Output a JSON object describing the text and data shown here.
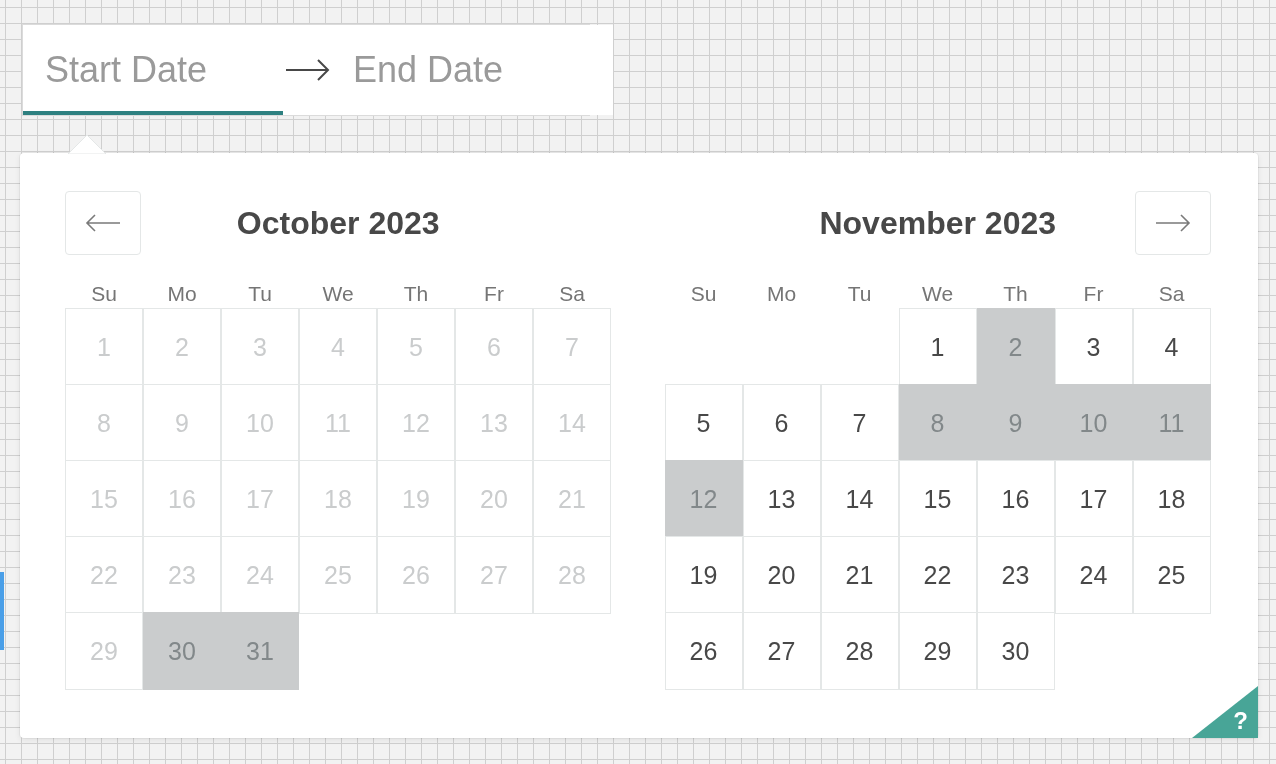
{
  "date_range": {
    "start": {
      "placeholder": "Start Date",
      "selected": true
    },
    "end": {
      "placeholder": "End Date",
      "selected": false
    }
  },
  "months": [
    {
      "title": "October 2023",
      "prev_button": true,
      "next_button": false,
      "weekdays": [
        "Su",
        "Mo",
        "Tu",
        "We",
        "Th",
        "Fr",
        "Sa"
      ],
      "weeks": [
        [
          {
            "label": "1",
            "disabled": true,
            "highlighted": false
          },
          {
            "label": "2",
            "disabled": true,
            "highlighted": false
          },
          {
            "label": "3",
            "disabled": true,
            "highlighted": false
          },
          {
            "label": "4",
            "disabled": true,
            "highlighted": false
          },
          {
            "label": "5",
            "disabled": true,
            "highlighted": false
          },
          {
            "label": "6",
            "disabled": true,
            "highlighted": false
          },
          {
            "label": "7",
            "disabled": true,
            "highlighted": false
          }
        ],
        [
          {
            "label": "8",
            "disabled": true,
            "highlighted": false
          },
          {
            "label": "9",
            "disabled": true,
            "highlighted": false
          },
          {
            "label": "10",
            "disabled": true,
            "highlighted": false
          },
          {
            "label": "11",
            "disabled": true,
            "highlighted": false
          },
          {
            "label": "12",
            "disabled": true,
            "highlighted": false
          },
          {
            "label": "13",
            "disabled": true,
            "highlighted": false
          },
          {
            "label": "14",
            "disabled": true,
            "highlighted": false
          }
        ],
        [
          {
            "label": "15",
            "disabled": true,
            "highlighted": false
          },
          {
            "label": "16",
            "disabled": true,
            "highlighted": false
          },
          {
            "label": "17",
            "disabled": true,
            "highlighted": false
          },
          {
            "label": "18",
            "disabled": true,
            "highlighted": false
          },
          {
            "label": "19",
            "disabled": true,
            "highlighted": false
          },
          {
            "label": "20",
            "disabled": true,
            "highlighted": false
          },
          {
            "label": "21",
            "disabled": true,
            "highlighted": false
          }
        ],
        [
          {
            "label": "22",
            "disabled": true,
            "highlighted": false
          },
          {
            "label": "23",
            "disabled": true,
            "highlighted": false
          },
          {
            "label": "24",
            "disabled": true,
            "highlighted": false
          },
          {
            "label": "25",
            "disabled": true,
            "highlighted": false
          },
          {
            "label": "26",
            "disabled": true,
            "highlighted": false
          },
          {
            "label": "27",
            "disabled": true,
            "highlighted": false
          },
          {
            "label": "28",
            "disabled": true,
            "highlighted": false
          }
        ],
        [
          {
            "label": "29",
            "disabled": true,
            "highlighted": false
          },
          {
            "label": "30",
            "disabled": true,
            "highlighted": true
          },
          {
            "label": "31",
            "disabled": true,
            "highlighted": true
          }
        ]
      ]
    },
    {
      "title": "November 2023",
      "prev_button": false,
      "next_button": true,
      "weekdays": [
        "Su",
        "Mo",
        "Tu",
        "We",
        "Th",
        "Fr",
        "Sa"
      ],
      "weeks": [
        [
          {
            "label": "1",
            "disabled": false,
            "highlighted": false
          },
          {
            "label": "2",
            "disabled": false,
            "highlighted": true
          },
          {
            "label": "3",
            "disabled": false,
            "highlighted": false
          },
          {
            "label": "4",
            "disabled": false,
            "highlighted": false
          }
        ],
        [
          {
            "label": "5",
            "disabled": false,
            "highlighted": false
          },
          {
            "label": "6",
            "disabled": false,
            "highlighted": false
          },
          {
            "label": "7",
            "disabled": false,
            "highlighted": false
          },
          {
            "label": "8",
            "disabled": false,
            "highlighted": true
          },
          {
            "label": "9",
            "disabled": false,
            "highlighted": true
          },
          {
            "label": "10",
            "disabled": false,
            "highlighted": true
          },
          {
            "label": "11",
            "disabled": false,
            "highlighted": true
          }
        ],
        [
          {
            "label": "12",
            "disabled": false,
            "highlighted": true
          },
          {
            "label": "13",
            "disabled": false,
            "highlighted": false
          },
          {
            "label": "14",
            "disabled": false,
            "highlighted": false
          },
          {
            "label": "15",
            "disabled": false,
            "highlighted": false
          },
          {
            "label": "16",
            "disabled": false,
            "highlighted": false
          },
          {
            "label": "17",
            "disabled": false,
            "highlighted": false
          },
          {
            "label": "18",
            "disabled": false,
            "highlighted": false
          }
        ],
        [
          {
            "label": "19",
            "disabled": false,
            "highlighted": false
          },
          {
            "label": "20",
            "disabled": false,
            "highlighted": false
          },
          {
            "label": "21",
            "disabled": false,
            "highlighted": false
          },
          {
            "label": "22",
            "disabled": false,
            "highlighted": false
          },
          {
            "label": "23",
            "disabled": false,
            "highlighted": false
          },
          {
            "label": "24",
            "disabled": false,
            "highlighted": false
          },
          {
            "label": "25",
            "disabled": false,
            "highlighted": false
          }
        ],
        [
          {
            "label": "26",
            "disabled": false,
            "highlighted": false
          },
          {
            "label": "27",
            "disabled": false,
            "highlighted": false
          },
          {
            "label": "28",
            "disabled": false,
            "highlighted": false
          },
          {
            "label": "29",
            "disabled": false,
            "highlighted": false
          },
          {
            "label": "30",
            "disabled": false,
            "highlighted": false
          }
        ]
      ]
    }
  ],
  "help": {
    "label": "?"
  }
}
